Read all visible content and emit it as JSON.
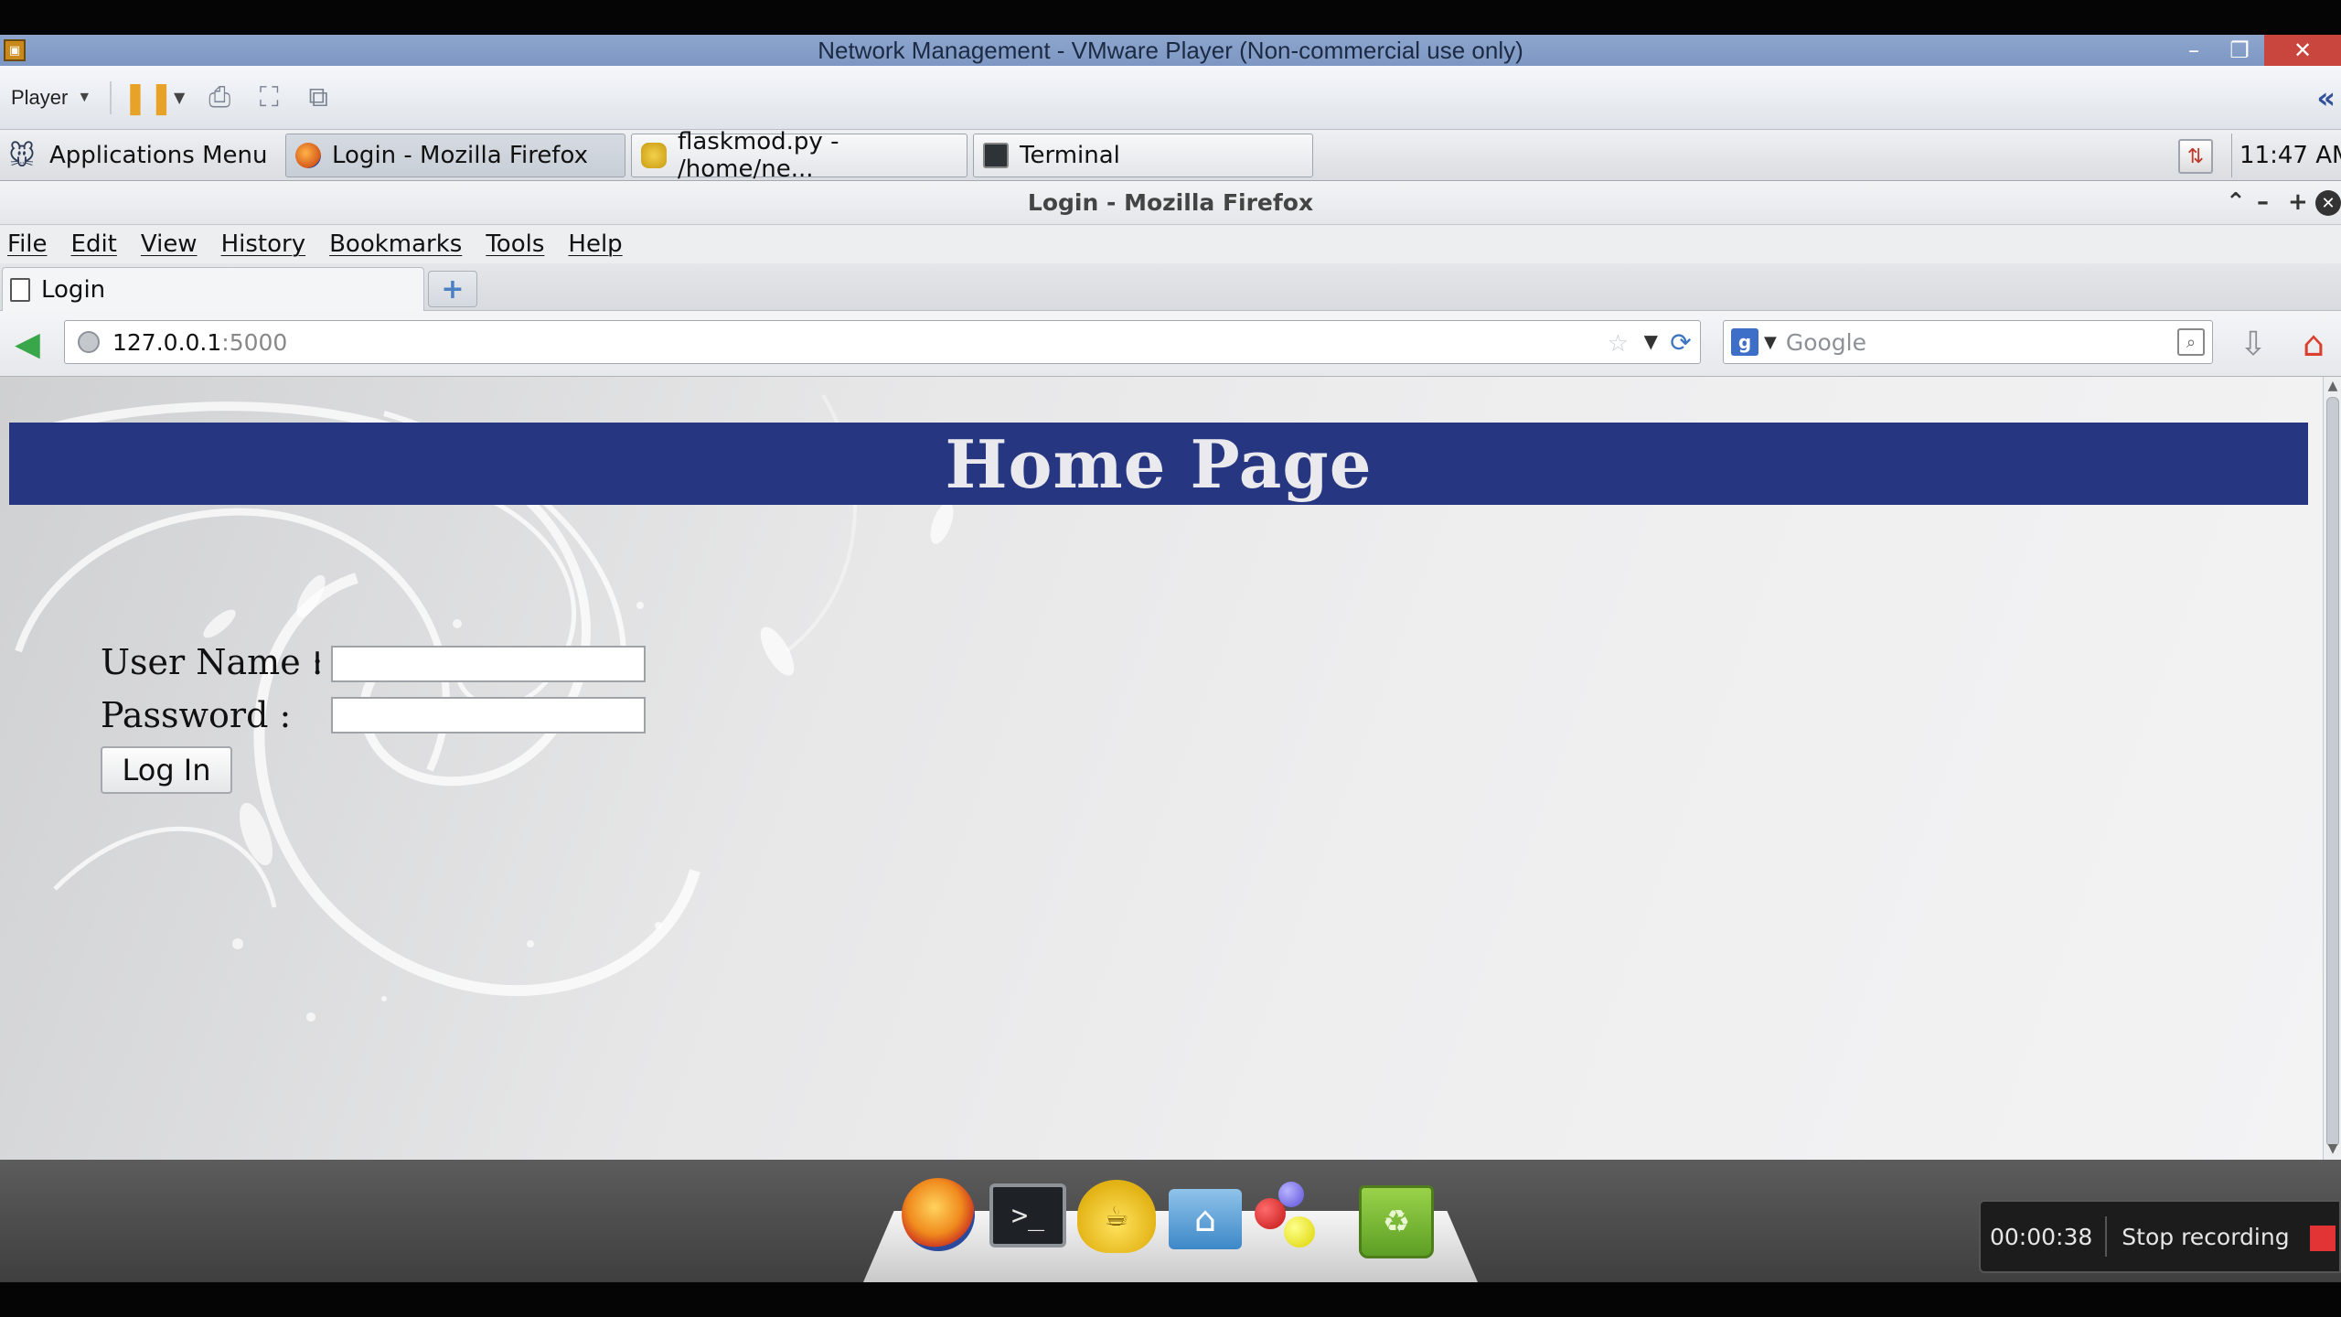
{
  "vm": {
    "title": "Network Management - VMware Player (Non-commercial use only)",
    "player_menu_label": "Player"
  },
  "taskbar": {
    "apps_menu_label": "Applications Menu",
    "tasks": [
      {
        "label": "Login - Mozilla Firefox"
      },
      {
        "label": "flaskmod.py - /home/ne..."
      },
      {
        "label": "Terminal"
      }
    ],
    "clock": "11:47 AM"
  },
  "firefox": {
    "window_title": "Login - Mozilla Firefox",
    "menus": [
      "File",
      "Edit",
      "View",
      "History",
      "Bookmarks",
      "Tools",
      "Help"
    ],
    "tab_title": "Login",
    "url_host": "127.0.0.1",
    "url_port": ":5000",
    "search_placeholder": "Google"
  },
  "page": {
    "heading": "Home Page",
    "username_label": "User Name :",
    "password_label": "Password :",
    "username_value": "",
    "password_value": "",
    "login_button": "Log In",
    "banner_color": "#263680"
  },
  "recorder": {
    "elapsed": "00:00:38",
    "stop_label": "Stop recording"
  },
  "icons": {
    "vm": "vmware-logo-icon",
    "back": "back-arrow-icon",
    "reload": "reload-icon",
    "home": "home-icon",
    "download": "download-icon"
  }
}
